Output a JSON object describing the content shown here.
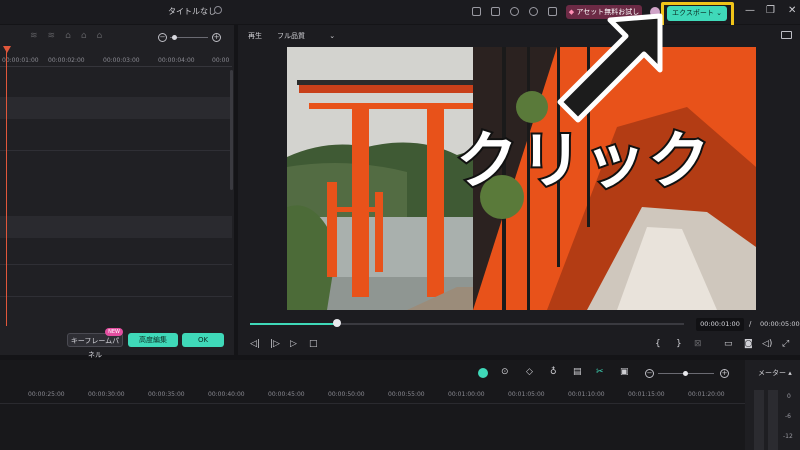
{
  "window": {
    "title": "タイトルなし",
    "asset_button": "アセット無料お試し",
    "export_button": "エクスポート",
    "window_controls": [
      "—",
      "❐",
      "✕"
    ]
  },
  "left_panel": {
    "ruler_ticks": [
      "00:00:01:00",
      "00:00:02:00",
      "00:00:03:00",
      "00:00:04:00",
      "00:00"
    ],
    "keyframe_panel_button": "キーフレームパネル",
    "new_badge": "NEW",
    "advanced_edit_button": "高度編集",
    "ok_button": "OK"
  },
  "preview": {
    "play_label": "再生",
    "quality_select": "フル品質",
    "current_time": "00:00:01:00",
    "separator": "/",
    "total_time": "00:00:05:00",
    "progress": 0.2,
    "scene": "torii-gates-lake-photo"
  },
  "timeline": {
    "ruler_ticks": [
      "00:00:25:00",
      "00:00:30:00",
      "00:00:35:00",
      "00:00:40:00",
      "00:00:45:00",
      "00:00:50:00",
      "00:00:55:00",
      "00:01:00:00",
      "00:01:05:00",
      "00:01:10:00",
      "00:01:15:00",
      "00:01:20:00"
    ]
  },
  "meter": {
    "label": "メーター",
    "levels": [
      "0",
      "-6",
      "-12"
    ]
  },
  "annotation": {
    "callout_text": "クリック"
  },
  "colors": {
    "accent": "#3fd9b9",
    "highlight": "#f0c419",
    "playhead": "#e0573b",
    "torii": "#e8521a"
  }
}
